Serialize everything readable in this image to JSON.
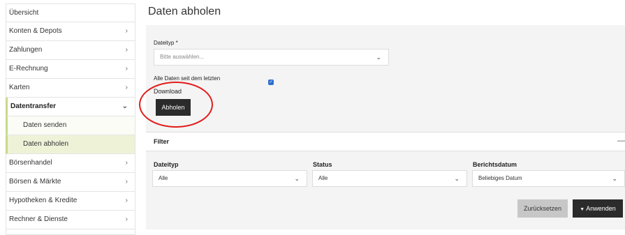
{
  "sidebar": {
    "items": [
      {
        "label": "Übersicht",
        "chevron": ""
      },
      {
        "label": "Konten & Depots",
        "chevron": "›"
      },
      {
        "label": "Zahlungen",
        "chevron": "›"
      },
      {
        "label": "E-Rechnung",
        "chevron": "›"
      },
      {
        "label": "Karten",
        "chevron": "›"
      },
      {
        "label": "Datentransfer",
        "chevron": "⌄"
      },
      {
        "label": "Daten senden",
        "chevron": ""
      },
      {
        "label": "Daten abholen",
        "chevron": ""
      },
      {
        "label": "Börsenhandel",
        "chevron": "›"
      },
      {
        "label": "Börsen & Märkte",
        "chevron": "›"
      },
      {
        "label": "Hypotheken & Kredite",
        "chevron": "›"
      },
      {
        "label": "Rechner & Dienste",
        "chevron": "›"
      }
    ]
  },
  "main": {
    "title": "Daten abholen",
    "filetype_label": "Dateityp *",
    "filetype_placeholder": "Bitte auswählen...",
    "checkbox_label_line1": "Alle Daten seit dem letzten",
    "checkbox_label_line2": "Download",
    "checkbox_mark": "✓",
    "fetch_button": "Abholen"
  },
  "filter": {
    "title": "Filter",
    "collapse_symbol": "—",
    "columns": [
      {
        "label": "Dateityp",
        "value": "Alle"
      },
      {
        "label": "Status",
        "value": "Alle"
      },
      {
        "label": "Berichtsdatum",
        "value": "Beliebiges Datum"
      }
    ],
    "reset_button": "Zurücksetzen",
    "apply_button": "Anwenden",
    "apply_icon": "▼",
    "caret": "⌄"
  },
  "colors": {
    "accent_green": "#c8d98a",
    "highlight_ring": "#e21b1b",
    "checkbox_blue": "#2f6fd0",
    "dark_button": "#2b2b2b"
  }
}
